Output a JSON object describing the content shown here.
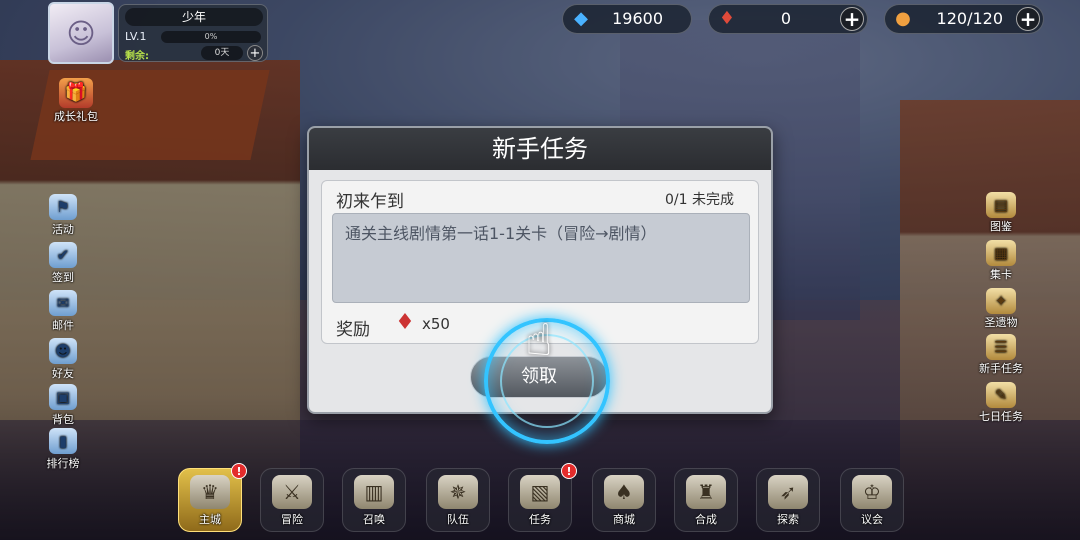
{
  "profile": {
    "name": "少年",
    "level": "LV.1",
    "exp": "0%",
    "remain_label": "剩余:",
    "remain_value": "0天",
    "plus": "+"
  },
  "resources": [
    {
      "icon": "crystal-icon",
      "value": "19600",
      "plus": ""
    },
    {
      "icon": "gem-icon",
      "value": "0",
      "plus": "+"
    },
    {
      "icon": "stamina-icon",
      "value": "120/120",
      "plus": "+"
    }
  ],
  "left_menu": {
    "gift_label": "成长礼包",
    "items": [
      {
        "icon": "activity-icon",
        "label": "活动"
      },
      {
        "icon": "checkin-icon",
        "label": "签到"
      },
      {
        "icon": "mail-icon",
        "label": "邮件"
      },
      {
        "icon": "friends-icon",
        "label": "好友"
      },
      {
        "icon": "backpack-icon",
        "label": "背包"
      },
      {
        "icon": "ranking-icon",
        "label": "排行榜"
      }
    ]
  },
  "right_menu": {
    "items": [
      {
        "icon": "book-icon",
        "label": "图鉴"
      },
      {
        "icon": "cards-icon",
        "label": "集卡"
      },
      {
        "icon": "relic-icon",
        "label": "圣遗物"
      },
      {
        "icon": "scroll-icon",
        "label": "新手任务"
      },
      {
        "icon": "quill-icon",
        "label": "七日任务"
      }
    ]
  },
  "bottom_menu": {
    "items": [
      {
        "icon": "crown-icon",
        "label": "主城",
        "badge": "!",
        "active": true
      },
      {
        "icon": "swords-icon",
        "label": "冒险",
        "badge": ""
      },
      {
        "icon": "summon-card-icon",
        "label": "召唤",
        "badge": ""
      },
      {
        "icon": "team-crest-icon",
        "label": "队伍",
        "badge": ""
      },
      {
        "icon": "quest-scroll-icon",
        "label": "任务",
        "badge": "!"
      },
      {
        "icon": "shop-mushroom-icon",
        "label": "商城",
        "badge": ""
      },
      {
        "icon": "forge-icon",
        "label": "合成",
        "badge": ""
      },
      {
        "icon": "explore-bow-icon",
        "label": "探索",
        "badge": ""
      },
      {
        "icon": "council-icon",
        "label": "议会",
        "badge": ""
      }
    ]
  },
  "dialog": {
    "title": "新手任务",
    "quest_name": "初来乍到",
    "progress": "0/1 未完成",
    "description": "通关主线剧情第一话1-1关卡（冒险→剧情）",
    "reward_label": "奖励",
    "reward_icon": "gem-icon",
    "reward_qty": "x50",
    "claim_label": "领取"
  }
}
